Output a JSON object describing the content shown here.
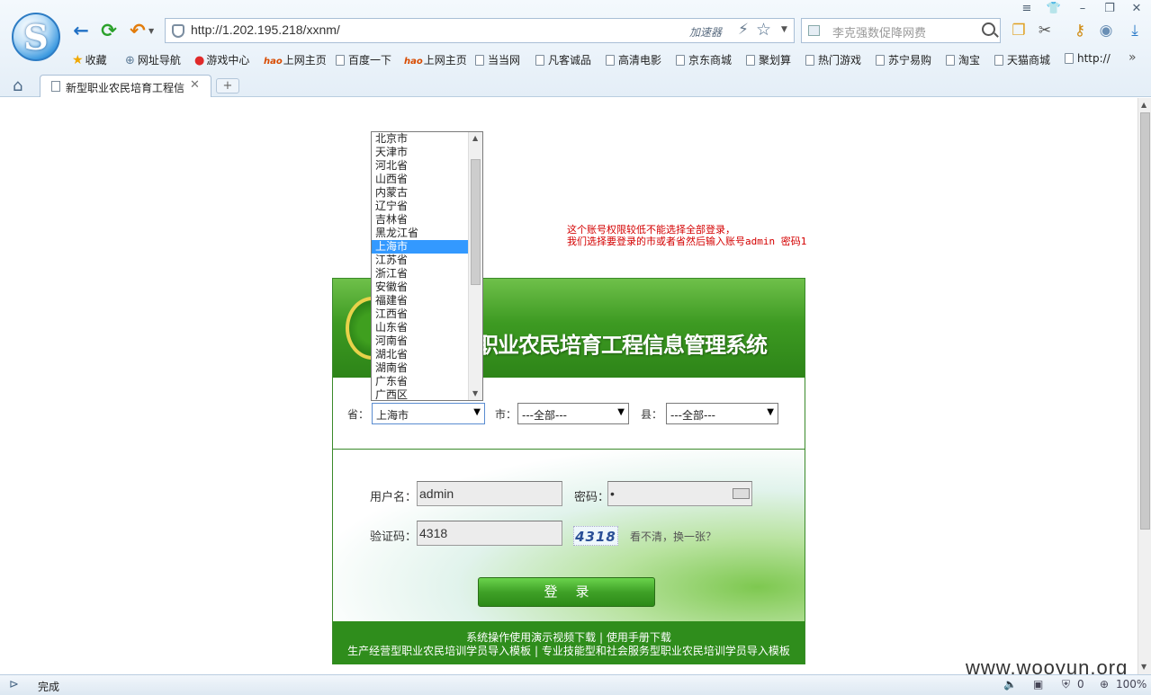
{
  "browser": {
    "address": {
      "url": "http://1.202.195.218/xxnm/",
      "accelerator_label": "加速器"
    },
    "search": {
      "placeholder": "李克强数促降网费"
    },
    "bookmarks": [
      {
        "label": "收藏",
        "icon": "star-icon"
      },
      {
        "label": "网址导航",
        "icon": "globe-icon"
      },
      {
        "label": "游戏中心",
        "icon": "game-icon"
      },
      {
        "label": "上网主页",
        "icon": "hao-icon"
      },
      {
        "label": "百度一下",
        "icon": "page-icon"
      },
      {
        "label": "上网主页",
        "icon": "hao-icon"
      },
      {
        "label": "当当网",
        "icon": "page-icon"
      },
      {
        "label": "凡客诚品",
        "icon": "page-icon"
      },
      {
        "label": "高清电影",
        "icon": "page-icon"
      },
      {
        "label": "京东商城",
        "icon": "page-icon"
      },
      {
        "label": "聚划算",
        "icon": "page-icon"
      },
      {
        "label": "热门游戏",
        "icon": "page-icon"
      },
      {
        "label": "苏宁易购",
        "icon": "page-icon"
      },
      {
        "label": "淘宝",
        "icon": "page-icon"
      },
      {
        "label": "天猫商城",
        "icon": "page-icon"
      },
      {
        "label": "http://",
        "icon": "page-icon"
      }
    ],
    "tab": {
      "title": "新型职业农民培育工程信"
    },
    "status": {
      "text": "完成",
      "count": "0",
      "zoom": "100%"
    }
  },
  "page": {
    "note_line1": "这个账号权限较低不能选择全部登录，",
    "note_line2": "我们选择要登录的市或者省然后输入账号admin 密码1",
    "system_title": "职业农民培育工程信息管理系统",
    "region": {
      "province_label": "省：",
      "province_value": "上海市",
      "city_label": "市：",
      "city_value": "---全部---",
      "county_label": "县：",
      "county_value": "---全部---"
    },
    "province_options": [
      "北京市",
      "天津市",
      "河北省",
      "山西省",
      "内蒙古",
      "辽宁省",
      "吉林省",
      "黑龙江省",
      "上海市",
      "江苏省",
      "浙江省",
      "安徽省",
      "福建省",
      "江西省",
      "山东省",
      "河南省",
      "湖北省",
      "湖南省",
      "广东省",
      "广西区"
    ],
    "selected_province_index": 8,
    "form": {
      "username_label": "用户名：",
      "username_value": "admin",
      "password_label": "密码：",
      "password_mask": "•",
      "captcha_label": "验证码：",
      "captcha_value": "4318",
      "captcha_image_text": "4318",
      "captcha_refresh": "看不清，换一张？",
      "login_button": "登录"
    },
    "footer": {
      "line1": "系统操作使用演示视频下载 | 使用手册下载",
      "line2": "生产经营型职业农民培训学员导入模板 | 专业技能型和社会服务型职业农民培训学员导入模板"
    },
    "watermark": "www.wooyun.org"
  }
}
